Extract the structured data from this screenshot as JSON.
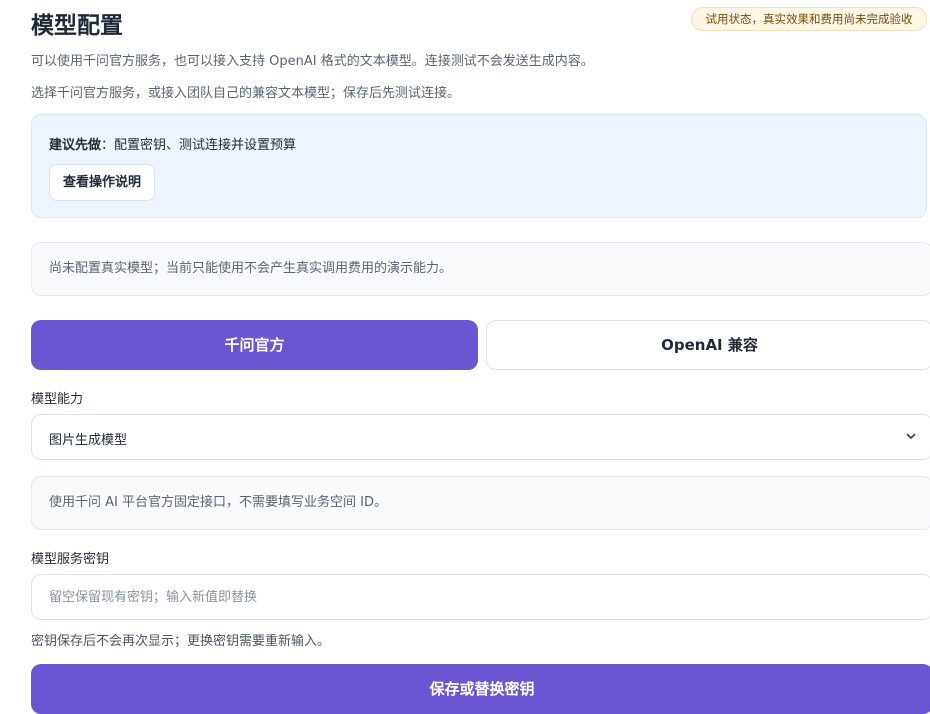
{
  "page": {
    "title": "模型配置",
    "status_badge": "试用状态，真实效果和费用尚未完成验收",
    "description_1": "可以使用千问官方服务，也可以接入支持 OpenAI 格式的文本模型。连接测试不会发送生成内容。",
    "description_2": "选择千问官方服务，或接入团队自己的兼容文本模型；保存后先测试连接。"
  },
  "tip": {
    "strong": "建议先做",
    "colon": "：",
    "text": "配置密钥、测试连接并设置预算",
    "button_label": "查看操作说明"
  },
  "notice": {
    "text": "尚未配置真实模型；当前只能使用不会产生真实调用费用的演示能力。"
  },
  "provider_tabs": {
    "active": "千问官方",
    "inactive": "OpenAI 兼容"
  },
  "capability": {
    "label": "模型能力",
    "selected": "图片生成模型"
  },
  "endpoint_info": {
    "text": "使用千问 AI 平台官方固定接口，不需要填写业务空间 ID。"
  },
  "api_key": {
    "label": "模型服务密钥",
    "placeholder": "留空保留现有密钥；输入新值即替换",
    "value": "",
    "help": "密钥保存后不会再次显示；更换密钥需要重新输入。",
    "save_button": "保存或替换密钥"
  },
  "icons": {
    "select_arrow": "chevron-down-icon"
  },
  "colors": {
    "accent": "#6a55d3",
    "badge_bg": "#fdf6e3",
    "badge_text": "#7a4a12",
    "tip_bg": "#eef4fd"
  }
}
